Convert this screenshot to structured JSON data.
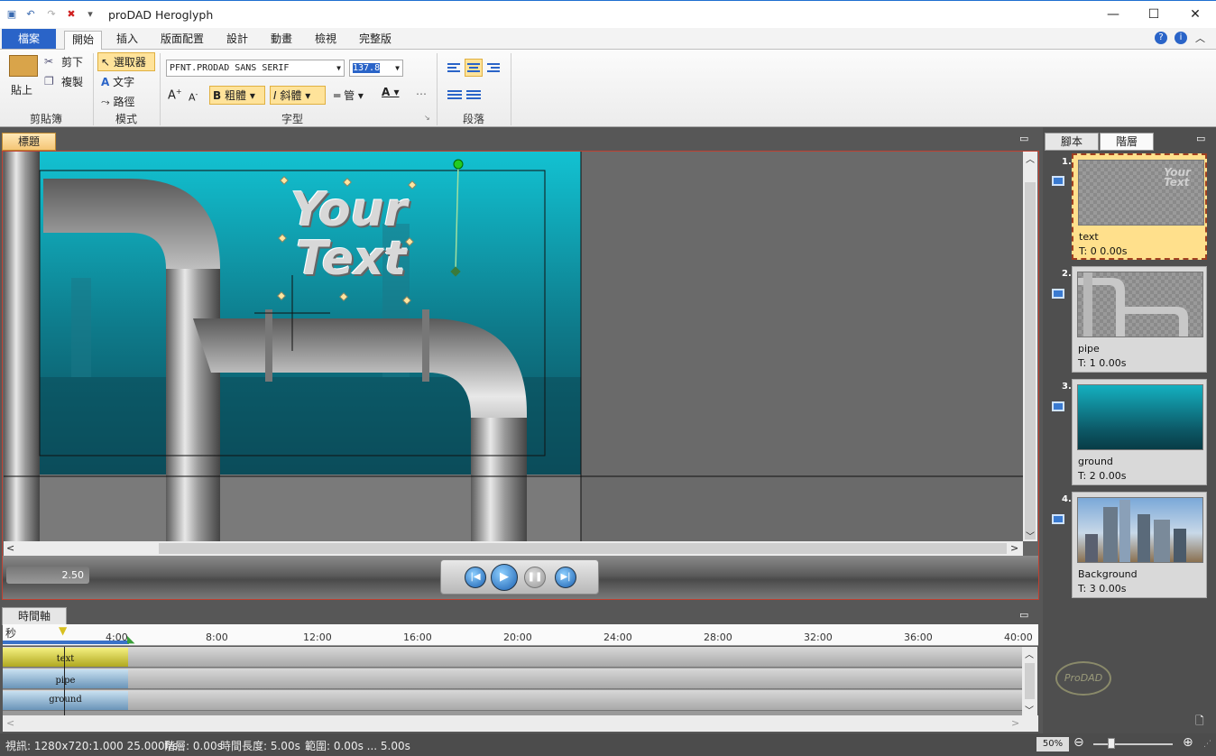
{
  "window": {
    "title": "proDAD Heroglyph"
  },
  "ribbon": {
    "file_tab": "檔案",
    "tabs": [
      "開始",
      "插入",
      "版面配置",
      "設計",
      "動畫",
      "檢視",
      "完整版"
    ],
    "clipboard": {
      "paste": "貼上",
      "cut": "剪下",
      "copy": "複製",
      "label": "剪貼簿"
    },
    "mode": {
      "selector": "選取器",
      "text": "文字",
      "path": "路徑",
      "label": "模式"
    },
    "font": {
      "family": "PFNT.PRODAD SANS SERIF",
      "size": "137.8",
      "bold": "粗體",
      "italic": "斜體",
      "outline": "管",
      "label": "字型"
    },
    "paragraph": {
      "label": "段落"
    }
  },
  "preview": {
    "tab": "標題",
    "sample_text": [
      "Your",
      "Text"
    ],
    "time": "2.50"
  },
  "timeline": {
    "tab": "時間軸",
    "unit": "秒",
    "ticks": [
      "4:00",
      "8:00",
      "12:00",
      "16:00",
      "20:00",
      "24:00",
      "28:00",
      "32:00",
      "36:00",
      "40:00"
    ],
    "tracks": [
      "text",
      "pipe",
      "ground"
    ]
  },
  "layers_panel": {
    "tabs": [
      "腳本",
      "階層"
    ],
    "layers": [
      {
        "num": "1.",
        "name": "text",
        "time": "T: 0  0.00s"
      },
      {
        "num": "2.",
        "name": "pipe",
        "time": "T: 1  0.00s"
      },
      {
        "num": "3.",
        "name": "ground",
        "time": "T: 2  0.00s"
      },
      {
        "num": "4.",
        "name": "Background",
        "time": "T: 3  0.00s"
      }
    ],
    "logo": "ProDAD"
  },
  "status": {
    "video": "視訊: 1280x720:1.000  25.000f/s",
    "layer": "階層: 0.00s",
    "duration": "時間長度: 5.00s",
    "range": "範圍: 0.00s ... 5.00s",
    "zoom": "50%"
  },
  "colors": {
    "accent": "#2a64c8",
    "selection": "#ffe08c",
    "stage_teal": "#12b8c8"
  }
}
